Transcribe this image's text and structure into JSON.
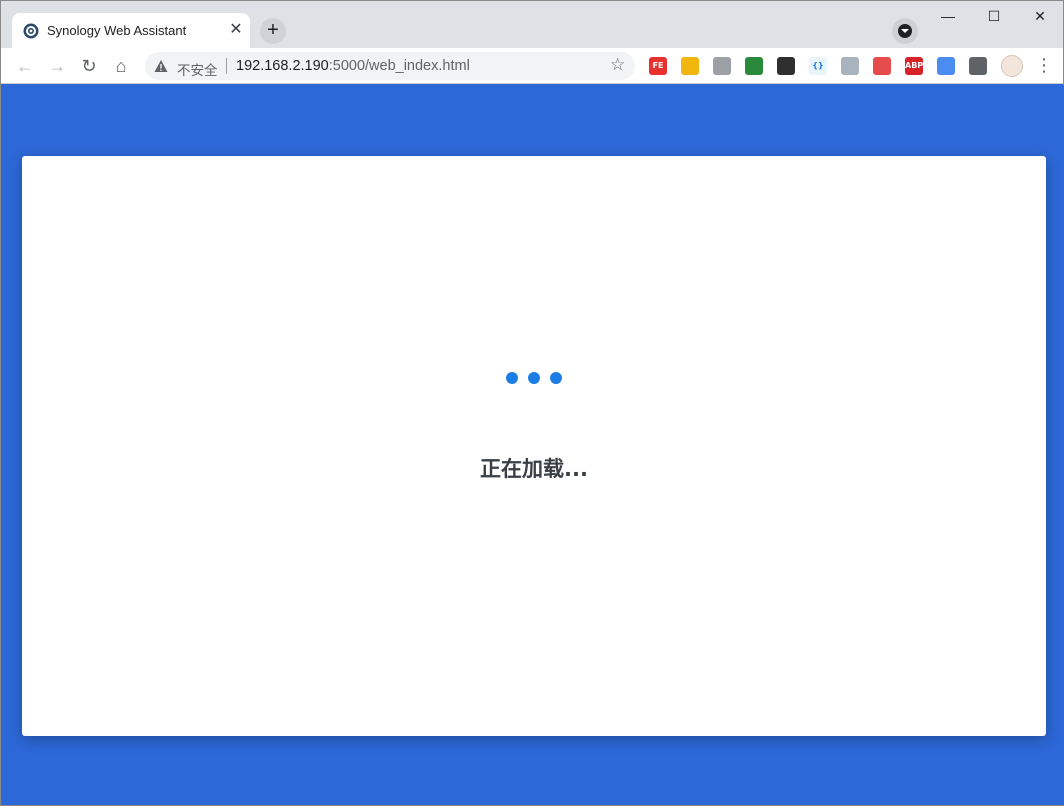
{
  "browser": {
    "tab": {
      "title": "Synology Web Assistant",
      "close_glyph": "✕",
      "favicon": "synology-assistant-icon"
    },
    "new_tab_glyph": "+",
    "window_controls": {
      "minimize": "—",
      "maximize": "☐",
      "close": "✕"
    },
    "nav": {
      "back": "←",
      "forward": "→",
      "reload": "↻",
      "home": "⌂"
    },
    "address_bar": {
      "security_label": "不安全",
      "url_host": "192.168.2.190",
      "url_rest": ":5000/web_index.html"
    },
    "bookmark_glyph": "☆",
    "extensions": [
      {
        "name": "fe-helper-extension",
        "label": "FE",
        "color": "#e8312f"
      },
      {
        "name": "tampermonkey-cat-extension",
        "label": "",
        "color": "#f2b70f"
      },
      {
        "name": "wheel-extension",
        "label": "",
        "color": "#9aa0a6"
      },
      {
        "name": "globe-extension",
        "label": "",
        "color": "#2a8a3c"
      },
      {
        "name": "tampermonkey-extension",
        "label": "",
        "color": "#2f2f2f"
      },
      {
        "name": "json-extension",
        "label": "{}",
        "color": "#e9f4fb"
      },
      {
        "name": "image-extension",
        "label": "",
        "color": "#a8b3bd"
      },
      {
        "name": "photo-red-extension",
        "label": "",
        "color": "#e74c4c"
      },
      {
        "name": "adblock-plus-extension",
        "label": "ABP",
        "color": "#d8222a"
      },
      {
        "name": "bird-extension",
        "label": "",
        "color": "#4a8cf0"
      },
      {
        "name": "puzzle-extension",
        "label": "",
        "color": "#5f6368"
      },
      {
        "name": "profile-avatar",
        "label": "",
        "color": "#f2e6dc"
      }
    ],
    "menu_glyph": "⋮"
  },
  "page": {
    "loading_text": "正在加载...",
    "accent_color": "#1a7ee6",
    "background_color": "#2c68d7"
  }
}
